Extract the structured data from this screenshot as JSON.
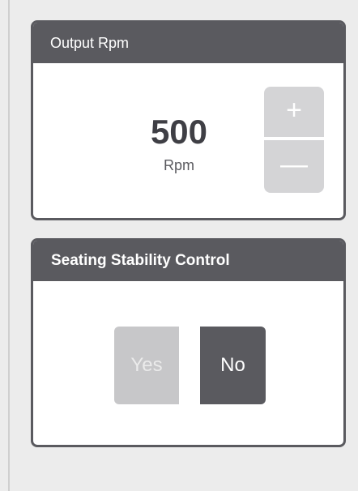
{
  "output_rpm": {
    "title": "Output Rpm",
    "value": "500",
    "unit": "Rpm",
    "increment_label": "+",
    "decrement_label": "—"
  },
  "seating_stability": {
    "title": "Seating Stability Control",
    "yes_label": "Yes",
    "no_label": "No",
    "selected": "No"
  },
  "colors": {
    "header_bg": "#5a5a5f",
    "page_bg": "#ececec",
    "button_disabled": "#d4d4d6",
    "toggle_inactive": "#c7c7c9",
    "toggle_active": "#5a5a5f"
  }
}
